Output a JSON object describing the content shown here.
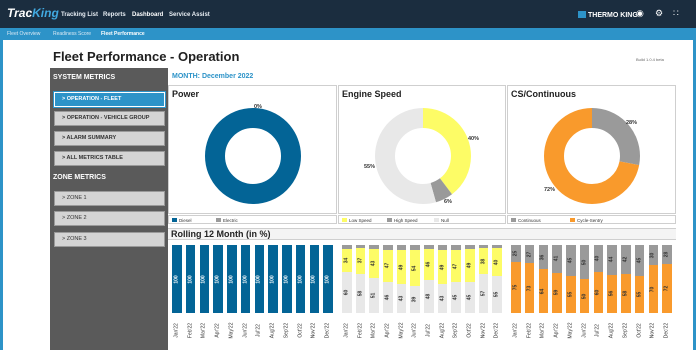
{
  "topbar": {
    "logo_a": "Trac",
    "logo_b": "King",
    "nav": [
      "Tracking List",
      "Reports",
      "Dashboard",
      "Service Assist"
    ],
    "brand": "THERMO KING",
    "icons": [
      "headset-icon",
      "settings-icon",
      "apps-grid-icon"
    ]
  },
  "subnav": [
    "Fleet Overview",
    "Readiness Score",
    "Fleet Performance"
  ],
  "page": {
    "title": "Fleet Performance - Operation",
    "build": "Build 1.0.4 beta",
    "month": "MONTH: December 2022",
    "rolling_title": "Rolling 12 Month (in %)"
  },
  "sidebar": {
    "system_head": "SYSTEM METRICS",
    "system_items": [
      "> OPERATION - FLEET",
      "> OPERATION - VEHICLE GROUP",
      "> ALARM SUMMARY",
      "> ALL METRICS TABLE"
    ],
    "zone_head": "ZONE METRICS",
    "zone_items": [
      "> ZONE 1",
      "> ZONE 2",
      "> ZONE 3"
    ]
  },
  "colors": {
    "blue": "#036496",
    "yellow": "#fdfc66",
    "grey": "#9a9a9a",
    "light": "#e8e8e8",
    "orange": "#f99a2c",
    "accent": "#2d93c8",
    "topbar": "#1b2d3f"
  },
  "chart_data": [
    {
      "type": "pie",
      "title": "Power",
      "labels": [
        "Diesel",
        "Electric"
      ],
      "values": [
        100,
        0
      ],
      "value_labels": [
        "",
        "0%"
      ]
    },
    {
      "type": "pie",
      "title": "Engine Speed",
      "labels": [
        "Low Speed",
        "High Speed",
        "Null"
      ],
      "values": [
        40,
        6,
        55
      ],
      "value_labels": [
        "40%",
        "6%",
        "55%"
      ]
    },
    {
      "type": "pie",
      "title": "CS/Continuous",
      "labels": [
        "Continuous",
        "Cycle-Sentry"
      ],
      "values": [
        28,
        72
      ],
      "value_labels": [
        "28%",
        "72%"
      ]
    },
    {
      "type": "bar",
      "stacked": true,
      "categories": [
        "Jan'22",
        "Feb'22",
        "Mar'22",
        "Apr'22",
        "May'22",
        "Jun'22",
        "Jul'22",
        "Aug'22",
        "Sep'22",
        "Oct'22",
        "Nov'22",
        "Dec'22"
      ],
      "series": [
        {
          "name": "Diesel",
          "values": [
            100,
            100,
            100,
            100,
            100,
            100,
            100,
            100,
            100,
            100,
            100,
            100
          ]
        }
      ]
    },
    {
      "type": "bar",
      "stacked": true,
      "categories": [
        "Jan'22",
        "Feb'22",
        "Mar'22",
        "Apr'22",
        "May'22",
        "Jun'22",
        "Jul'22",
        "Aug'22",
        "Sep'22",
        "Oct'22",
        "Nov'22",
        "Dec'22"
      ],
      "series": [
        {
          "name": "Null",
          "values": [
            60,
            58,
            51,
            46,
            43,
            39,
            48,
            43,
            45,
            45,
            57,
            55
          ]
        },
        {
          "name": "Low Speed",
          "values": [
            34,
            37,
            43,
            47,
            49,
            54,
            46,
            49,
            47,
            49,
            38,
            40
          ]
        },
        {
          "name": "High Speed",
          "values": [
            6,
            5,
            6,
            7,
            8,
            7,
            6,
            8,
            8,
            6,
            5,
            5
          ]
        }
      ]
    },
    {
      "type": "bar",
      "stacked": true,
      "categories": [
        "Jan'22",
        "Feb'22",
        "Mar'22",
        "Apr'22",
        "May'22",
        "Jun'22",
        "Jul'22",
        "Aug'22",
        "Sep'22",
        "Oct'22",
        "Nov'22",
        "Dec'22"
      ],
      "series": [
        {
          "name": "Cycle-Sentry",
          "values": [
            75,
            73,
            64,
            59,
            55,
            50,
            60,
            56,
            58,
            55,
            70,
            72
          ]
        },
        {
          "name": "Continuous",
          "values": [
            25,
            27,
            36,
            41,
            45,
            50,
            40,
            44,
            42,
            45,
            30,
            28
          ]
        }
      ]
    }
  ]
}
